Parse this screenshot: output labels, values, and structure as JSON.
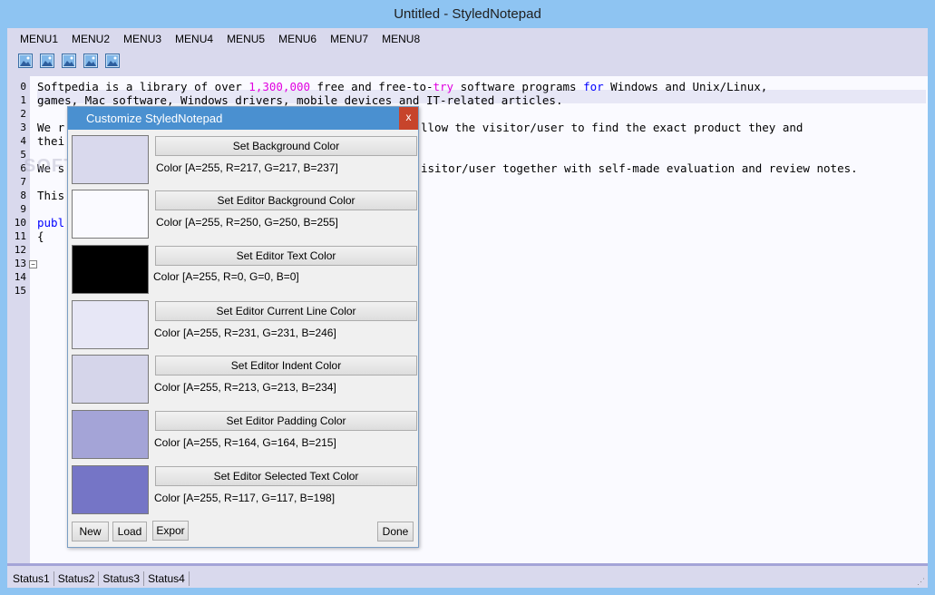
{
  "window": {
    "title": "Untitled - StyledNotepad"
  },
  "menubar": {
    "items": [
      "MENU1",
      "MENU2",
      "MENU3",
      "MENU4",
      "MENU5",
      "MENU6",
      "MENU7",
      "MENU8"
    ]
  },
  "toolbar": {
    "icons": [
      "picture-icon",
      "picture-icon",
      "picture-icon",
      "picture-icon",
      "picture-icon"
    ]
  },
  "editor": {
    "line_numbers": [
      "0",
      "1",
      "2",
      "3",
      "4",
      "5",
      "6",
      "7",
      "8",
      "9",
      "10",
      "11",
      "12",
      "13",
      "14",
      "15"
    ],
    "lines": {
      "l0_a": "Softpedia is a library of over ",
      "l0_num": "1,300,000",
      "l0_b": " free and free-to-",
      "l0_try": "try",
      "l0_c": " software programs ",
      "l0_for": "for",
      "l0_d": " Windows and Unix/Linux,",
      "l1": "games, Mac software, Windows drivers, mobile devices and IT-related articles.",
      "l3_a": "We r",
      "l3_b": "llow the visitor/user to find the exact product they and",
      "l4": "thei",
      "l6_a": "We s",
      "l6_b": "isitor/user together with self-made evaluation and review notes.",
      "l8": "This",
      "l10": "publ",
      "l11": "{"
    },
    "watermark": "SOFTPEDIA"
  },
  "dialog": {
    "title": "Customize StyledNotepad",
    "close_label": "x",
    "entries": [
      {
        "button": "Set Background Color",
        "color_text": "Color [A=255, R=217, G=217, B=237]",
        "swatch": "#d9d9ed"
      },
      {
        "button": "Set Editor Background Color",
        "color_text": "Color [A=255, R=250, G=250, B=255]",
        "swatch": "#fafaff"
      },
      {
        "button": "Set Editor Text Color",
        "color_text": "Color [A=255, R=0, G=0, B=0]",
        "swatch": "#000000"
      },
      {
        "button": "Set Editor Current Line Color",
        "color_text": "Color [A=255, R=231, G=231, B=246]",
        "swatch": "#e7e7f6"
      },
      {
        "button": "Set Editor Indent Color",
        "color_text": "Color [A=255, R=213, G=213, B=234]",
        "swatch": "#d5d5ea"
      },
      {
        "button": "Set Editor Padding Color",
        "color_text": "Color [A=255, R=164, G=164, B=215]",
        "swatch": "#a4a4d7"
      },
      {
        "button": "Set Editor Selected Text Color",
        "color_text": "Color [A=255, R=117, G=117, B=198]",
        "swatch": "#7575c6"
      }
    ],
    "buttons": {
      "new": "New",
      "load": "Load",
      "export": "Expor",
      "done": "Done"
    }
  },
  "statusbar": {
    "items": [
      "Status1",
      "Status2",
      "Status3",
      "Status4"
    ]
  }
}
